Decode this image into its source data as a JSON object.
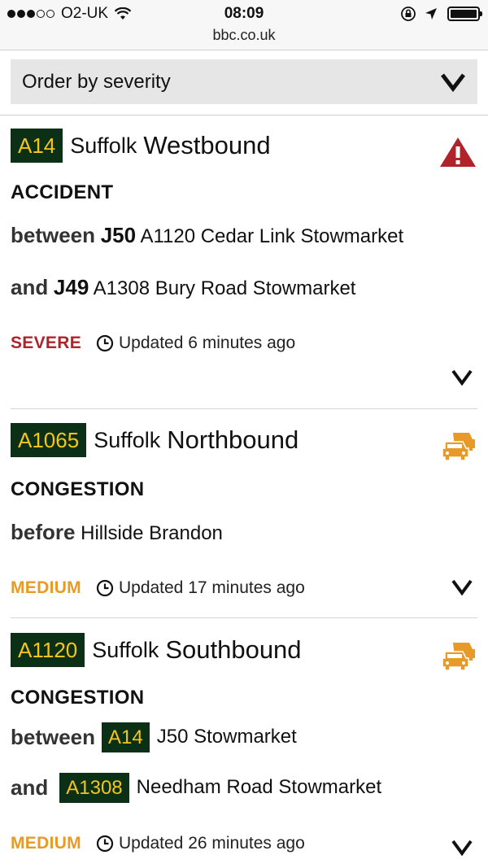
{
  "status_bar": {
    "carrier": "O2-UK",
    "time": "08:09",
    "url": "bbc.co.uk",
    "signal_icon": "signal-dots-icon",
    "wifi_icon": "wifi-icon",
    "battery_icon": "battery-icon"
  },
  "order_select": {
    "label": "Order by severity"
  },
  "colors": {
    "road_badge_bg": "#0b3016",
    "road_badge_text": "#f5c518",
    "severe": "#b0232b",
    "medium": "#e79a27"
  },
  "incidents": [
    {
      "road": "A14",
      "county": "Suffolk",
      "direction": "Westbound",
      "type": "ACCIDENT",
      "line1_kw": "between",
      "line1_junction": "J50",
      "line1_text": "A1120 Cedar Link Stowmarket",
      "line2_kw": "and",
      "line2_junction": "J49",
      "line2_text": "A1308 Bury Road Stowmarket",
      "severity": "SEVERE",
      "updated": "Updated 6 minutes ago",
      "icon": "warning-triangle-icon"
    },
    {
      "road": "A1065",
      "county": "Suffolk",
      "direction": "Northbound",
      "type": "CONGESTION",
      "line1_kw": "before",
      "line1_text": "Hillside Brandon",
      "severity": "MEDIUM",
      "updated": "Updated 17 minutes ago",
      "icon": "congestion-cars-icon"
    },
    {
      "road": "A1120",
      "county": "Suffolk",
      "direction": "Southbound",
      "type": "CONGESTION",
      "line1_kw": "between",
      "line1_badge": "A14",
      "line1_text": "J50 Stowmarket",
      "line2_kw": "and",
      "line2_badge": "A1308",
      "line2_text": "Needham Road Stowmarket",
      "severity": "MEDIUM",
      "updated": "Updated 26 minutes ago",
      "icon": "congestion-cars-icon"
    }
  ]
}
